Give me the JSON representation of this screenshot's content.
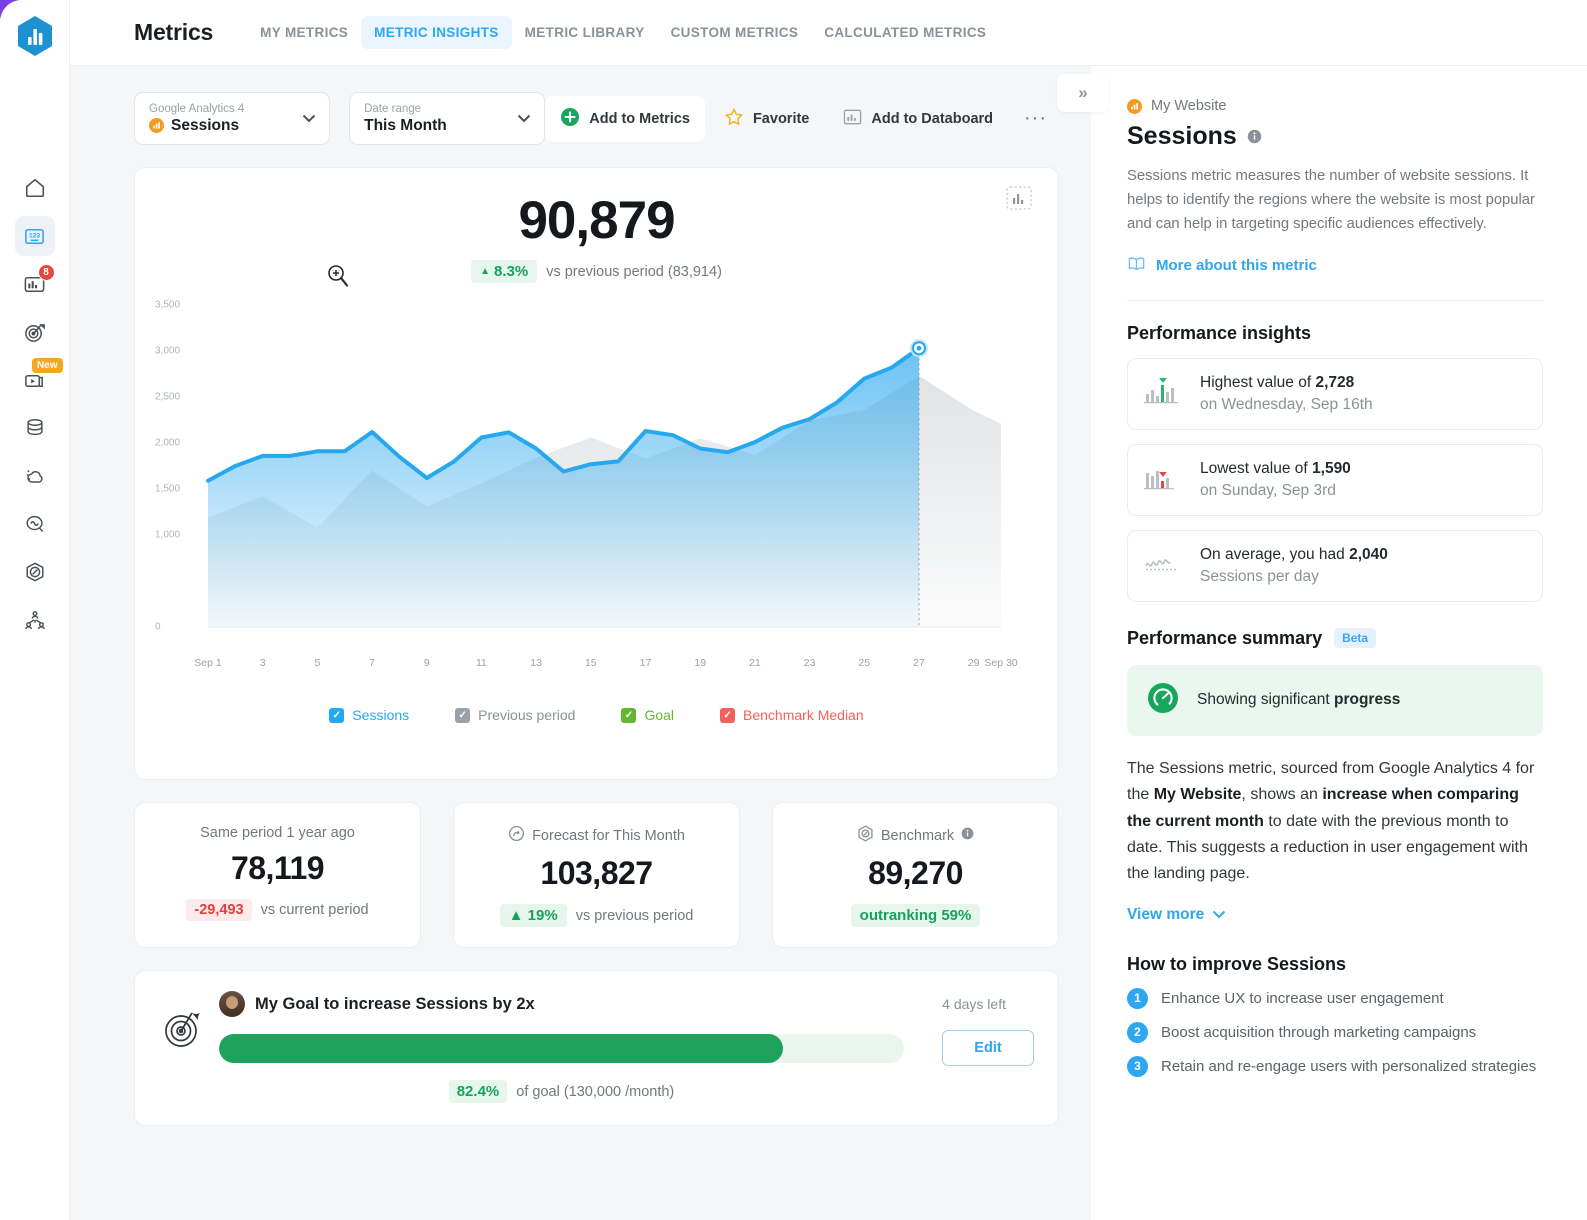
{
  "app": {
    "title": "Metrics",
    "logo_icon": "databox-logo-icon"
  },
  "tabs": [
    {
      "label": "MY METRICS",
      "active": false
    },
    {
      "label": "METRIC INSIGHTS",
      "active": true
    },
    {
      "label": "METRIC LIBRARY",
      "active": false
    },
    {
      "label": "CUSTOM METRICS",
      "active": false
    },
    {
      "label": "CALCULATED METRICS",
      "active": false
    }
  ],
  "rail": {
    "items": [
      {
        "name": "home-icon",
        "badge": null,
        "tag": null,
        "active": false
      },
      {
        "name": "metrics-icon",
        "badge": null,
        "tag": null,
        "active": true
      },
      {
        "name": "dashboards-icon",
        "badge": "8",
        "tag": null,
        "active": false
      },
      {
        "name": "goals-icon",
        "badge": null,
        "tag": null,
        "active": false
      },
      {
        "name": "loops-video-icon",
        "badge": null,
        "tag": "New",
        "active": false
      },
      {
        "name": "data-sources-icon",
        "badge": null,
        "tag": null,
        "active": false
      },
      {
        "name": "alerts-icon",
        "badge": null,
        "tag": null,
        "active": false
      },
      {
        "name": "insights-icon",
        "badge": null,
        "tag": null,
        "active": false
      },
      {
        "name": "benchmarks-icon",
        "badge": null,
        "tag": null,
        "active": false
      },
      {
        "name": "team-icon",
        "badge": null,
        "tag": null,
        "active": false
      }
    ]
  },
  "toolbar": {
    "source_label": "Google Analytics 4",
    "source_value": "Sessions",
    "range_label": "Date range",
    "range_value": "This Month",
    "add_to_metrics": "Add to Metrics",
    "favorite": "Favorite",
    "add_to_databoard": "Add to Databoard",
    "more": "···"
  },
  "chart_card": {
    "value": "90,879",
    "delta": "8.3%",
    "delta_arrow": "▲",
    "delta_sub": "vs previous period (83,914)"
  },
  "chart_data": {
    "type": "area",
    "title": "Sessions",
    "xlabel": "",
    "ylabel": "",
    "ylim": [
      0,
      3500
    ],
    "yticks": [
      "0",
      "1,000",
      "1,500",
      "2,000",
      "2,500",
      "3,000",
      "3,500"
    ],
    "ytick_values": [
      0,
      1000,
      1500,
      2000,
      2500,
      3000,
      3500
    ],
    "xticks": [
      "Sep 1",
      "3",
      "5",
      "7",
      "9",
      "11",
      "13",
      "15",
      "17",
      "19",
      "21",
      "23",
      "25",
      "27",
      "29",
      "Sep 30"
    ],
    "grid": false,
    "legend_position": "bottom",
    "marker_day": 27,
    "series": [
      {
        "name": "Sessions",
        "color": "#26a8f0",
        "checked": true,
        "x": [
          1,
          2,
          3,
          4,
          5,
          6,
          7,
          8,
          9,
          10,
          11,
          12,
          13,
          14,
          15,
          16,
          17,
          18,
          19,
          20,
          21,
          22,
          23,
          24,
          25,
          26,
          27
        ],
        "values": [
          1590,
          1750,
          1860,
          1860,
          1910,
          1910,
          2120,
          1850,
          1620,
          1800,
          2060,
          2115,
          1940,
          1690,
          1770,
          1800,
          2130,
          2085,
          1940,
          1900,
          2010,
          2165,
          2260,
          2440,
          2700,
          2820,
          3030
        ]
      },
      {
        "name": "Previous period",
        "color": "#9aa1a8",
        "checked": true,
        "x": [
          1,
          3,
          5,
          7,
          9,
          11,
          13,
          15,
          17,
          19,
          21,
          23,
          25,
          27,
          29,
          30
        ],
        "values": [
          1190,
          1420,
          1080,
          1700,
          1310,
          1560,
          1840,
          2060,
          1830,
          2050,
          1870,
          2240,
          2360,
          2730,
          2350,
          2210
        ]
      },
      {
        "name": "Goal",
        "color": "#63b832",
        "checked": true
      },
      {
        "name": "Benchmark Median",
        "color": "#f4605b",
        "checked": true
      }
    ]
  },
  "stats": [
    {
      "title": "Same period 1 year ago",
      "icon": null,
      "value": "78,119",
      "pill": "-29,493",
      "pill_tone": "red",
      "sub": "vs current period"
    },
    {
      "title": "Forecast for This Month",
      "icon": "forecast-icon",
      "value": "103,827",
      "pill": "▲ 19%",
      "pill_tone": "green",
      "sub": "vs previous period"
    },
    {
      "title": "Benchmark",
      "icon": "benchmark-icon",
      "value": "89,270",
      "pill": "outranking 59%",
      "pill_tone": "green",
      "sub": ""
    }
  ],
  "goal": {
    "title": "My Goal to increase Sessions by 2x",
    "days_left": "4 days left",
    "edit": "Edit",
    "percent": "82.4%",
    "percent_value": 82.4,
    "sub": "of goal (130,000 /month)"
  },
  "right": {
    "collapse": "»",
    "source": "My Website",
    "title": "Sessions",
    "description": "Sessions metric measures the number of website sessions. It helps to identify the regions where the website is most popular and can help in targeting specific audiences effectively.",
    "more_link": "More about this metric",
    "insights_heading": "Performance insights",
    "insights": [
      {
        "icon": "highest-value-icon",
        "line1_pre": "Highest value of ",
        "line1_bold": "2,728",
        "line2": "on Wednesday, Sep 16th"
      },
      {
        "icon": "lowest-value-icon",
        "line1_pre": "Lowest value of ",
        "line1_bold": "1,590",
        "line2": "on Sunday, Sep 3rd"
      },
      {
        "icon": "average-icon",
        "line1_pre": "On average, you had ",
        "line1_bold": "2,040",
        "line2": "Sessions per day"
      }
    ],
    "summary_heading": "Performance summary",
    "summary_badge": "Beta",
    "summary_status_pre": "Showing significant ",
    "summary_status_bold": "progress",
    "summary_p1": "The Sessions metric, sourced from Google Analytics 4 for the ",
    "summary_b1": "My Website",
    "summary_p2": ", shows an ",
    "summary_b2": "increase when comparing the current month",
    "summary_p3": " to date with the previous month to date. This suggests a reduction in user engagement with the landing page.",
    "view_more": "View more",
    "improve_heading": "How to improve Sessions",
    "tips": [
      "Enhance UX to increase user engagement",
      "Boost acquisition through marketing campaigns",
      "Retain and re-engage users with personalized strategies"
    ]
  }
}
